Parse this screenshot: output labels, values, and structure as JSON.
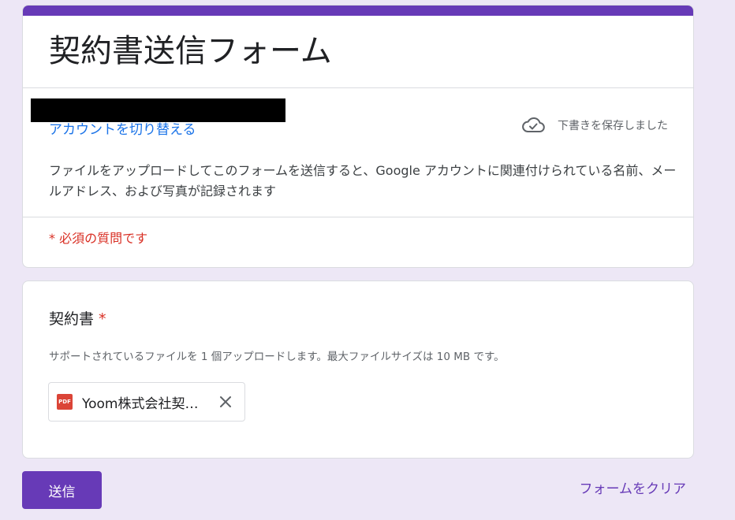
{
  "form": {
    "title": "契約書送信フォーム",
    "switch_account": "アカウントを切り替える",
    "save_status": "下書きを保存しました",
    "notice": "ファイルをアップロードしてこのフォームを送信すると、Google アカウントに関連付けられている名前、メールアドレス、および写真が記録されます",
    "required_note": "* 必須の質問です"
  },
  "question": {
    "title": "契約書",
    "required_mark": "*",
    "help": "サポートされているファイルを 1 個アップロードします。最大ファイルサイズは 10 MB です。",
    "file": {
      "type_label": "PDF",
      "name": "Yoom株式会社契…"
    }
  },
  "actions": {
    "submit_label": "送信",
    "clear_label": "フォームをクリア"
  },
  "colors": {
    "accent": "#673ab7",
    "background": "#ede7f6",
    "link": "#1a73e8",
    "required": "#d93025",
    "pdf_icon": "#db4437"
  },
  "icons": {
    "save_status": "cloud-done-icon",
    "file_type": "pdf-icon",
    "remove_file": "close-icon"
  }
}
